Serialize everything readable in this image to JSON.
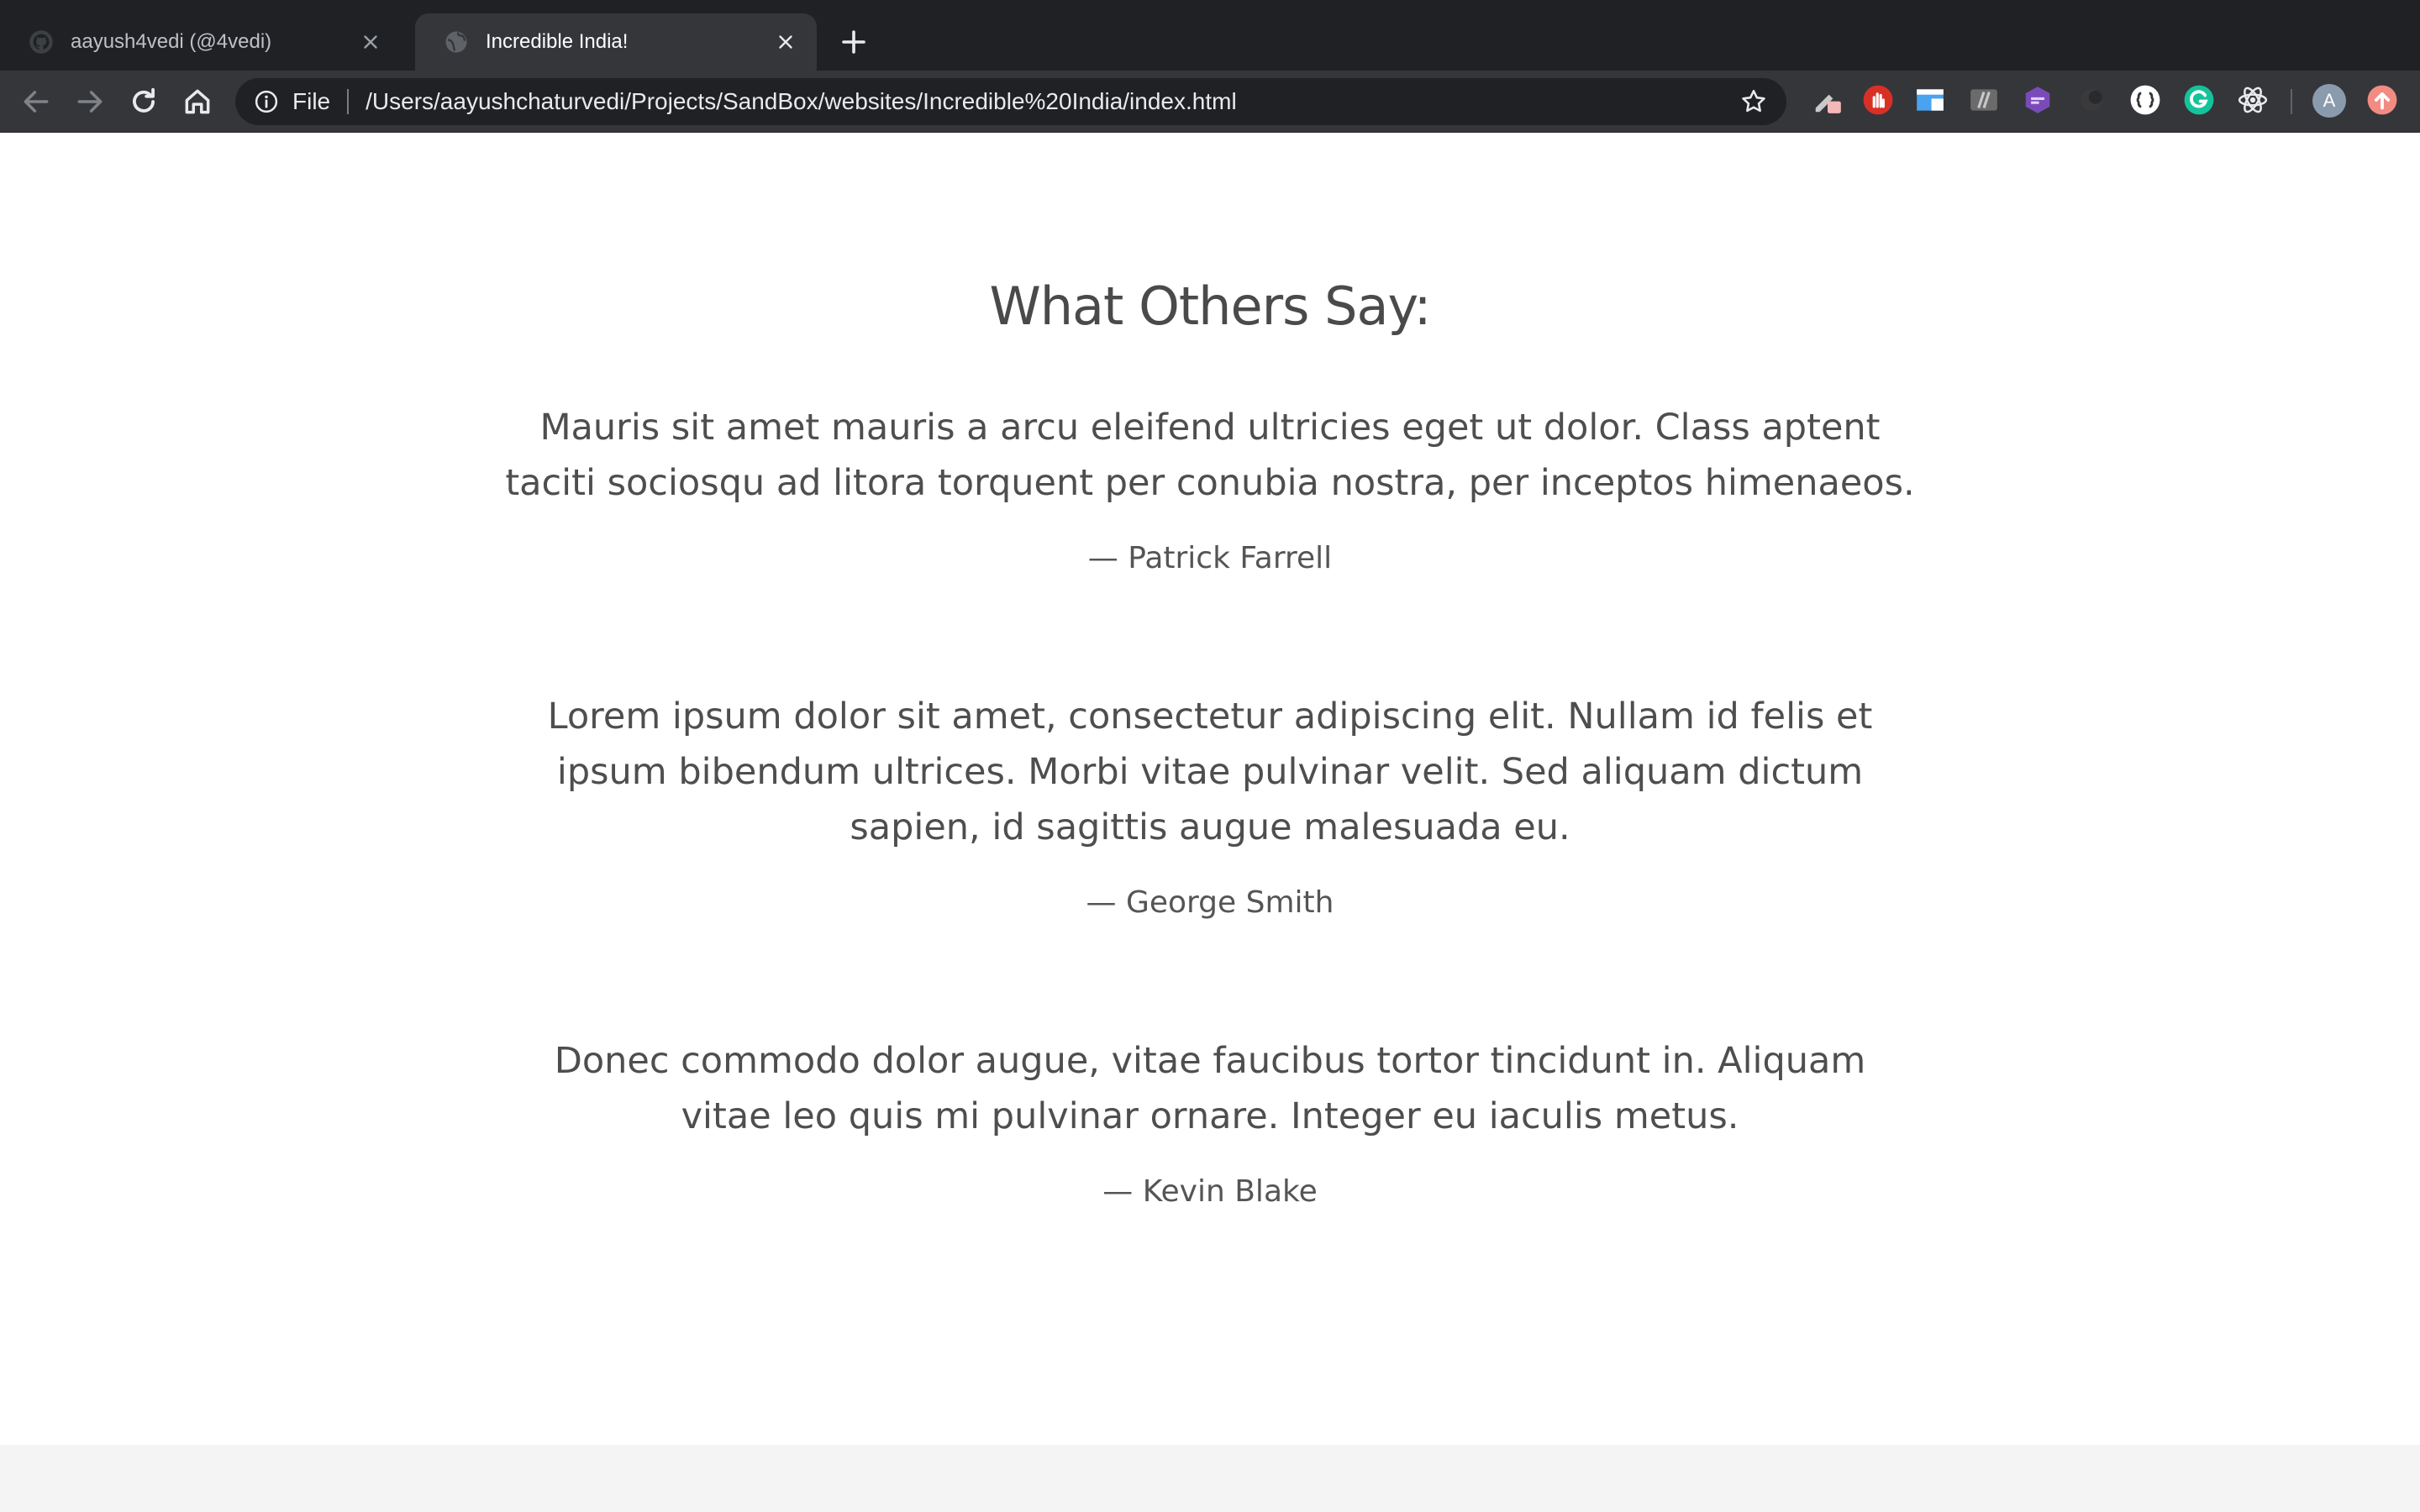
{
  "browser": {
    "tabs": [
      {
        "title": "aayush4vedi (@4vedi)",
        "favicon": "github-icon",
        "active": false
      },
      {
        "title": "Incredible India!",
        "favicon": "globe-icon",
        "active": true
      }
    ],
    "address": {
      "scheme": "File",
      "url": "/Users/aayushchaturvedi/Projects/SandBox/websites/Incredible%20India/index.html"
    },
    "profile_initial": "A",
    "extensions": [
      "pencil-extension-icon",
      "hand-stop-extension-icon",
      "window-extension-icon",
      "slash-extension-icon",
      "tag-extension-icon",
      "dark-extension-icon",
      "json-extension-icon",
      "grammarly-icon",
      "react-devtools-icon"
    ],
    "colors": {
      "tabstrip": "#202124",
      "toolbar": "#35363a",
      "omnibox": "#202124"
    }
  },
  "page": {
    "section_title": "What Others Say:",
    "testimonials": [
      {
        "quote": "Mauris sit amet mauris a arcu eleifend ultricies eget ut dolor. Class aptent taciti sociosqu ad litora torquent per conubia nostra, per inceptos himenaeos.",
        "author": "— Patrick Farrell"
      },
      {
        "quote": "Lorem ipsum dolor sit amet, consectetur adipiscing elit. Nullam id felis et ipsum bibendum ultrices. Morbi vitae pulvinar velit. Sed aliquam dictum sapien, id sagittis augue malesuada eu.",
        "author": "— George Smith"
      },
      {
        "quote": "Donec commodo dolor augue, vitae faucibus tortor tincidunt in. Aliquam vitae leo quis mi pulvinar ornare. Integer eu iaculis metus.",
        "author": "— Kevin Blake"
      }
    ],
    "colors": {
      "text": "#4a4a4a",
      "footer": "#f4f4f4"
    }
  }
}
